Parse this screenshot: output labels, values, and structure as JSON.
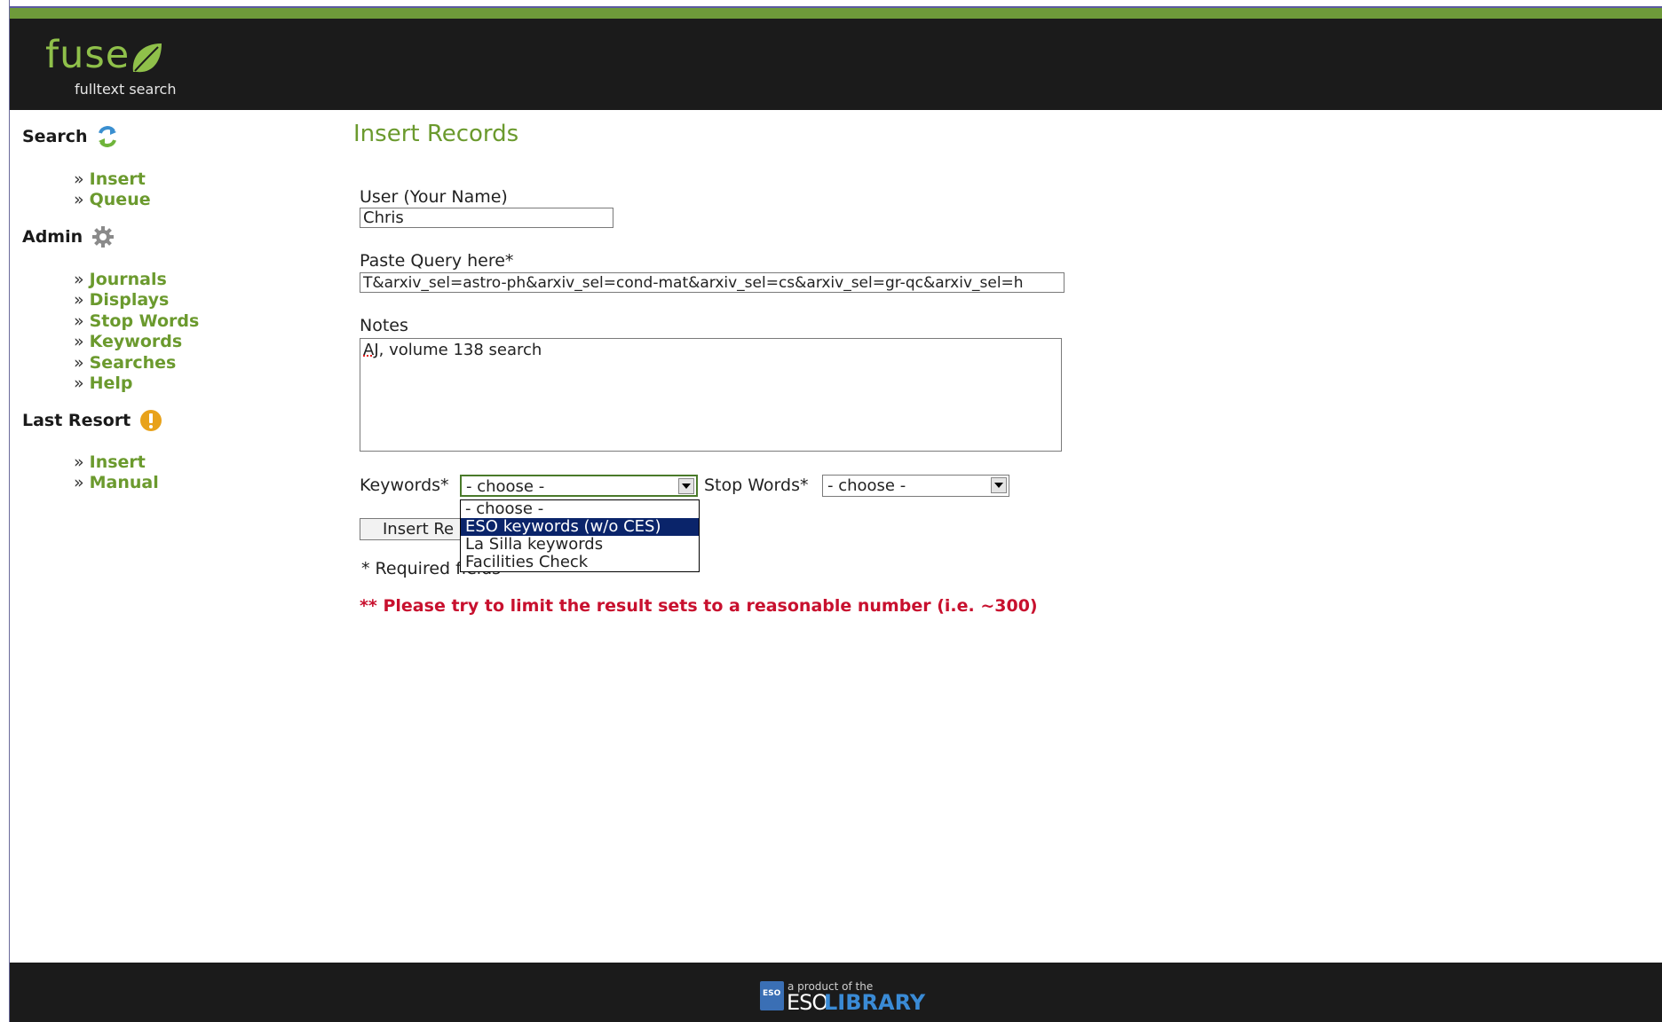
{
  "header": {
    "logo_text": "fuse",
    "logo_subtitle": "fulltext search",
    "stripe_color": "#6e9a3a"
  },
  "sidebar": {
    "search_heading": "Search",
    "search_links": [
      "Insert",
      "Queue"
    ],
    "admin_heading": "Admin",
    "admin_links": [
      "Journals",
      "Displays",
      "Stop Words",
      "Keywords",
      "Searches",
      "Help"
    ],
    "last_resort_heading": "Last Resort",
    "last_resort_links": [
      "Insert",
      "Manual"
    ],
    "link_prefix": "»",
    "link_color": "#6b9a2e"
  },
  "main": {
    "title": "Insert Records",
    "user_label": "User (Your Name)",
    "user_value": "Chris",
    "query_label": "Paste Query here*",
    "query_value": "T&arxiv_sel=astro-ph&arxiv_sel=cond-mat&arxiv_sel=cs&arxiv_sel=gr-qc&arxiv_sel=h",
    "notes_label": "Notes",
    "notes_value_spell": "AJ",
    "notes_value_rest": ", volume 138 search",
    "keywords_label": "Keywords*",
    "keywords_selected": "- choose -",
    "keywords_options": [
      "- choose -",
      "ESO keywords (w/o CES)",
      "La Silla keywords",
      "Facilities Check"
    ],
    "keywords_highlighted": "ESO keywords (w/o CES)",
    "stopwords_label": "Stop Words*",
    "stopwords_selected": "- choose -",
    "submit_label": "Insert Re",
    "required_note": "* Required fields",
    "limit_note": "** Please try to limit the result sets to a reasonable number (i.e. ~300)",
    "limit_color": "#c8102e"
  },
  "footer": {
    "small_text": "a product of the",
    "eso": "ESO",
    "library": "LIBRARY",
    "box_text": "ESO"
  }
}
